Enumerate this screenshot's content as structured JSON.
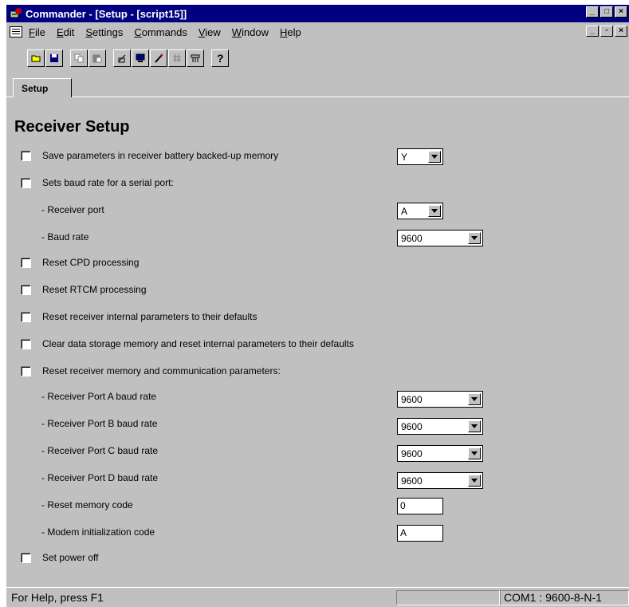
{
  "window": {
    "title": "Commander - [Setup - [script15]]",
    "buttons": {
      "minimize": "_",
      "maximize": "□",
      "close": "×"
    }
  },
  "menu": {
    "items": [
      {
        "label": "File",
        "acc": "F",
        "rest": "ile"
      },
      {
        "label": "Edit",
        "acc": "E",
        "rest": "dit"
      },
      {
        "label": "Settings",
        "acc": "S",
        "rest": "ettings"
      },
      {
        "label": "Commands",
        "acc": "C",
        "rest": "ommands"
      },
      {
        "label": "View",
        "acc": "V",
        "rest": "iew"
      },
      {
        "label": "Window",
        "acc": "W",
        "rest": "indow"
      },
      {
        "label": "Help",
        "acc": "H",
        "rest": "elp"
      }
    ],
    "mdi_buttons": {
      "minimize": "_",
      "restore": "▫",
      "close": "×"
    }
  },
  "toolbar": {
    "icons": [
      "open-folder-icon",
      "save-disk-icon",
      "copy-icon",
      "paste-icon",
      "script-edit-icon",
      "monitor-icon",
      "pencil-icon",
      "network-icon",
      "tool-icon",
      "help-icon"
    ],
    "help_glyph": "?"
  },
  "tabs": [
    {
      "label": "Setup"
    }
  ],
  "setup": {
    "heading": "Receiver Setup",
    "save_params": {
      "label": "Save parameters in receiver battery backed-up memory",
      "value": "Y"
    },
    "baud_serial": {
      "label": "Sets baud rate for a serial port:"
    },
    "receiver_port": {
      "label": "- Receiver port",
      "value": "A"
    },
    "baud_rate": {
      "label": "- Baud rate",
      "value": "9600"
    },
    "reset_cpd": {
      "label": "Reset CPD processing"
    },
    "reset_rtcm": {
      "label": "Reset RTCM processing"
    },
    "reset_internal": {
      "label": "Reset receiver internal parameters to their defaults"
    },
    "clear_storage": {
      "label": "Clear data storage memory and reset internal parameters to their defaults"
    },
    "reset_memory": {
      "label": "Reset receiver memory and communication parameters:"
    },
    "port_a": {
      "label": "- Receiver Port A baud rate",
      "value": "9600"
    },
    "port_b": {
      "label": "- Receiver Port B baud rate",
      "value": "9600"
    },
    "port_c": {
      "label": "- Receiver Port C baud rate",
      "value": "9600"
    },
    "port_d": {
      "label": "- Receiver Port D baud rate",
      "value": "9600"
    },
    "reset_code": {
      "label": "- Reset memory code",
      "value": "0"
    },
    "modem_code": {
      "label": "- Modem initialization code",
      "value": "A"
    },
    "power_off": {
      "label": "Set power off"
    }
  },
  "status": {
    "help": "For Help, press F1",
    "com": "COM1 : 9600-8-N-1"
  }
}
